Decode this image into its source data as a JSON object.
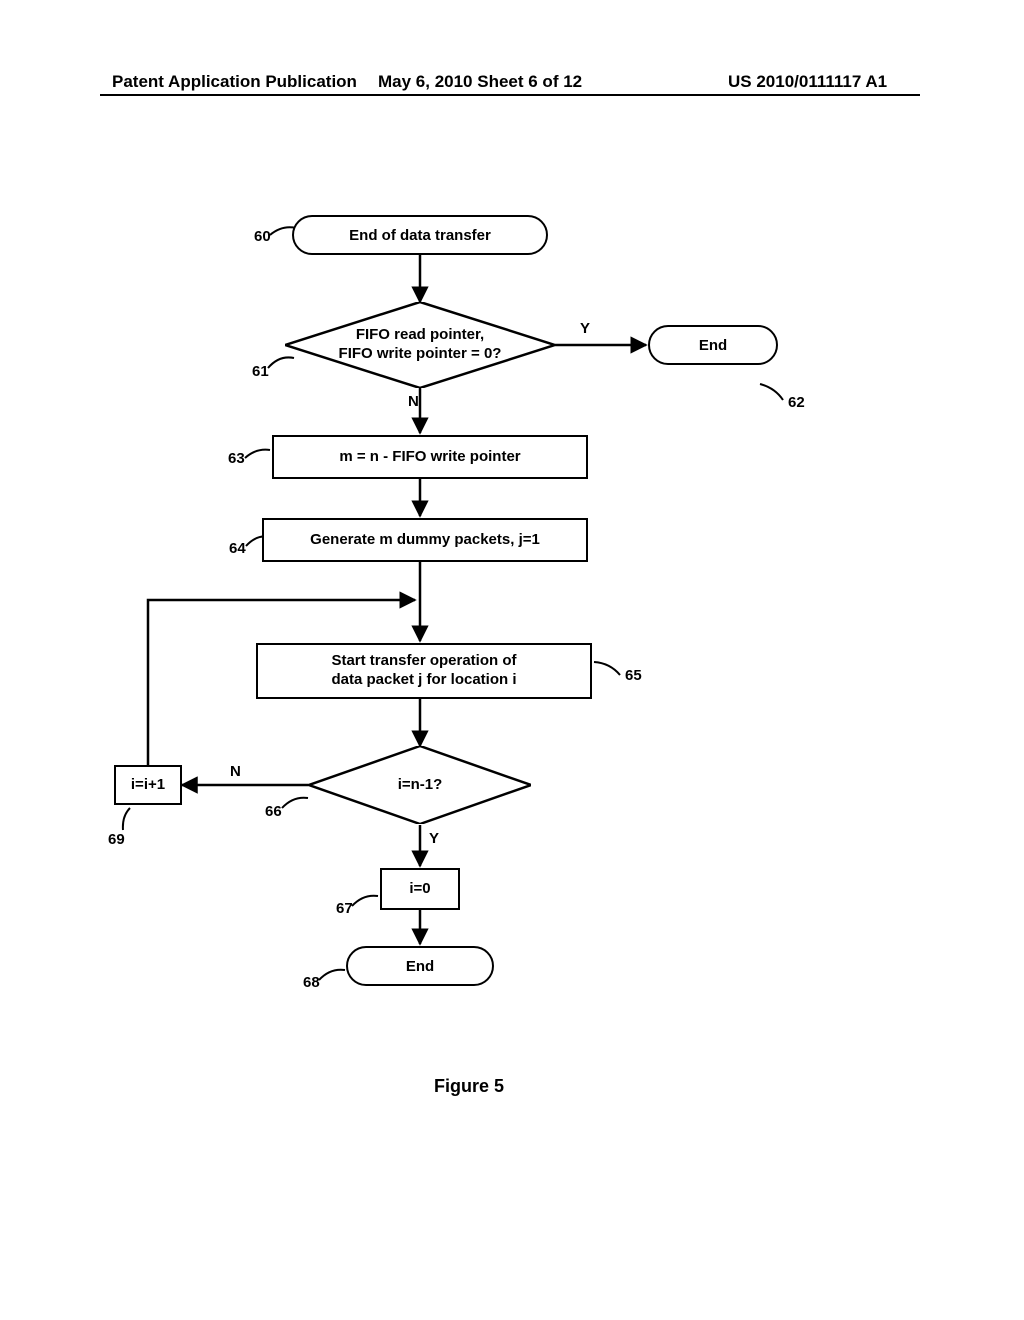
{
  "header": {
    "left": "Patent Application Publication",
    "mid": "May 6, 2010  Sheet 6 of 12",
    "right": "US 2010/0111117 A1"
  },
  "nodes": {
    "n60": "End of data transfer",
    "n61": "FIFO read pointer,\nFIFO write pointer = 0?",
    "n62": "End",
    "n63": "m = n - FIFO write pointer",
    "n64": "Generate m dummy packets, j=1",
    "n65": "Start transfer operation of\ndata packet j for location i",
    "n66": "i=n-1?",
    "n67": "i=0",
    "n68": "End",
    "n69": "i=i+1"
  },
  "refs": {
    "r60": "60",
    "r61": "61",
    "r62": "62",
    "r63": "63",
    "r64": "64",
    "r65": "65",
    "r66": "66",
    "r67": "67",
    "r68": "68",
    "r69": "69"
  },
  "edges": {
    "yes": "Y",
    "no": "N"
  },
  "caption": "Figure 5"
}
